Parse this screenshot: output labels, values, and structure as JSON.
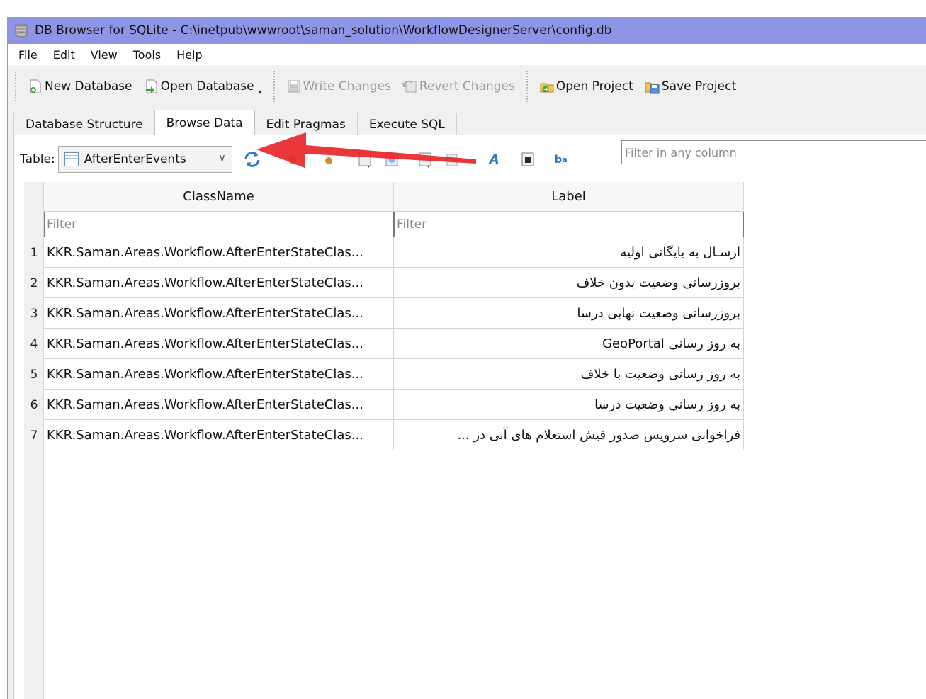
{
  "window": {
    "title": "DB Browser for SQLite - C:\\inetpub\\wwwroot\\saman_solution\\WorkflowDesignerServer\\config.db"
  },
  "menu": [
    "File",
    "Edit",
    "View",
    "Tools",
    "Help"
  ],
  "toolbar": {
    "new_database": "New Database",
    "open_database": "Open Database",
    "write_changes": "Write Changes",
    "revert_changes": "Revert Changes",
    "open_project": "Open Project",
    "save_project": "Save Project"
  },
  "tabs": [
    "Database Structure",
    "Browse Data",
    "Edit Pragmas",
    "Execute SQL"
  ],
  "active_tab": "Browse Data",
  "browse": {
    "table_label": "Table:",
    "table_value": "AfterEnterEvents",
    "filter_any_placeholder": "Filter in any column",
    "icons": [
      "refresh-icon",
      "clear-filters-icon",
      "save-filter-icon",
      "print-icon",
      "insert-record-icon",
      "delete-record-icon",
      "copy-icon",
      "find-icon",
      "find-replace-icon",
      "set-encoding-icon"
    ]
  },
  "grid": {
    "columns": [
      "ClassName",
      "Label"
    ],
    "filter_placeholder": "Filter",
    "rows": [
      {
        "num": "1",
        "classname": "KKR.Saman.Areas.Workflow.AfterEnterStateClas...",
        "label": "ارسـال به بایگانی اولیه"
      },
      {
        "num": "2",
        "classname": "KKR.Saman.Areas.Workflow.AfterEnterStateClas...",
        "label": "بروزرسانی وضعیت بدون خلاف"
      },
      {
        "num": "3",
        "classname": "KKR.Saman.Areas.Workflow.AfterEnterStateClas...",
        "label": "بروزرسانی وضعیت نهایی درسا"
      },
      {
        "num": "4",
        "classname": "KKR.Saman.Areas.Workflow.AfterEnterStateClas...",
        "label": "به روز رسانی GeoPortal"
      },
      {
        "num": "5",
        "classname": "KKR.Saman.Areas.Workflow.AfterEnterStateClas...",
        "label": "به روز رسانی وضعیت با خلاف"
      },
      {
        "num": "6",
        "classname": "KKR.Saman.Areas.Workflow.AfterEnterStateClas...",
        "label": "به روز رسانی وضعیت درسا"
      },
      {
        "num": "7",
        "classname": "KKR.Saman.Areas.Workflow.AfterEnterStateClas...",
        "label": "فراخوانی سرویس صدور فیش استعلام های آنی در ..."
      }
    ]
  },
  "annotation": {
    "color": "#e8262b"
  }
}
